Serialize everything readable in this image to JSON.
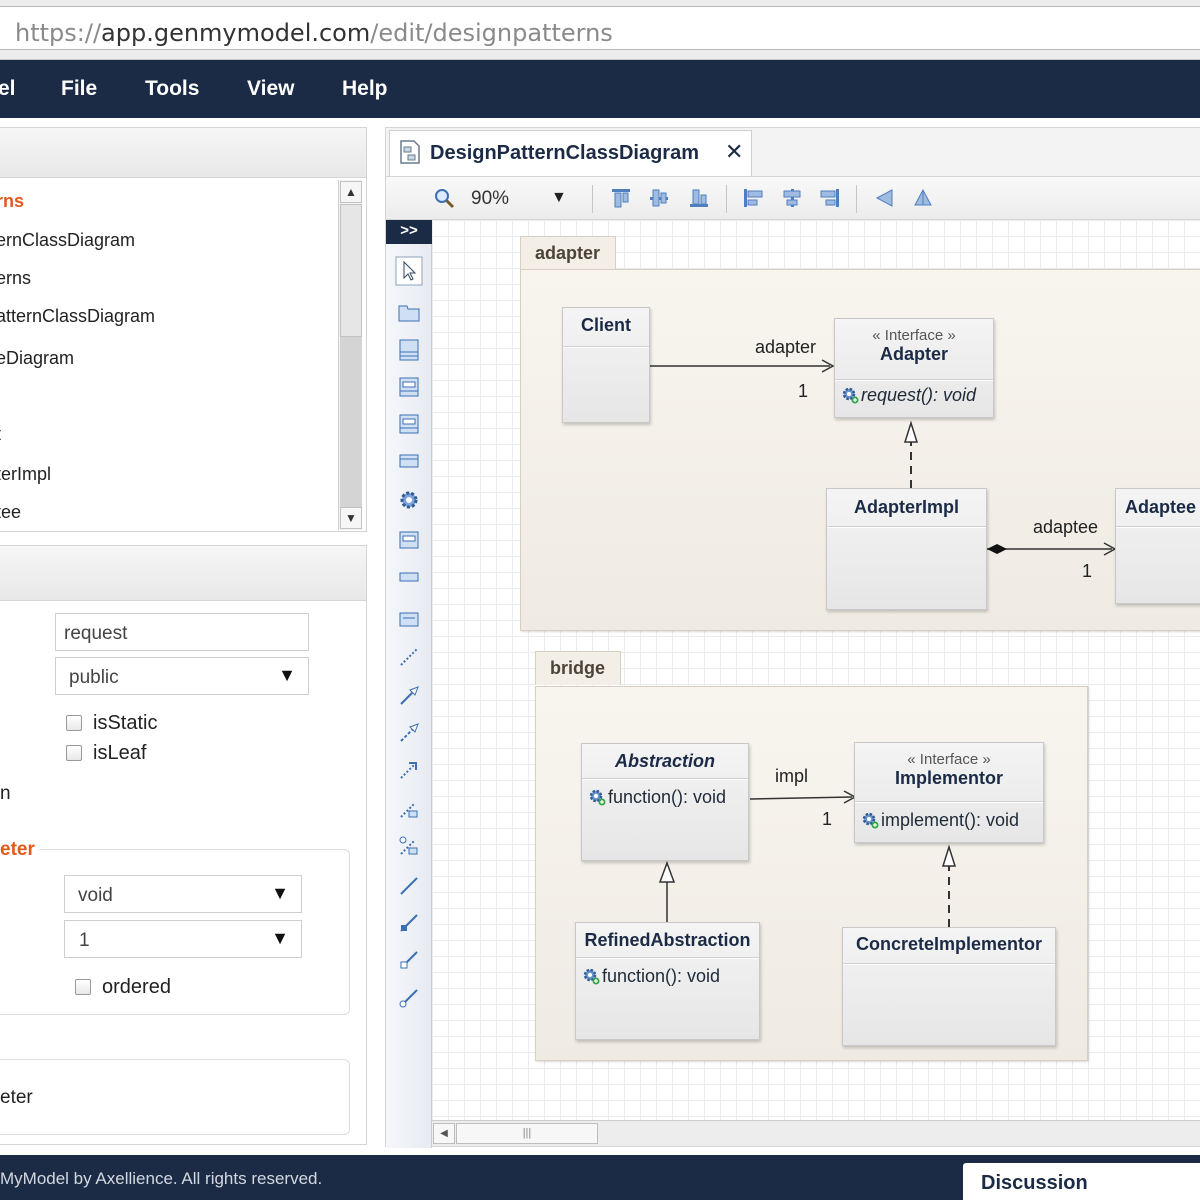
{
  "browser": {
    "url_scheme": "https://",
    "url_host": "app.genmymodel.com",
    "url_path": "/edit/designpatterns"
  },
  "menubar": {
    "items": [
      "el",
      "File",
      "Tools",
      "View",
      "Help"
    ]
  },
  "tree": {
    "items": [
      {
        "label": "rns",
        "selected": true
      },
      {
        "label": "ernClassDiagram"
      },
      {
        "label": "erns"
      },
      {
        "label": "atternClassDiagram"
      },
      {
        "label": "eDiagram"
      },
      {
        "label": "t"
      },
      {
        "label": "terImpl"
      },
      {
        "label": "tee"
      }
    ]
  },
  "properties": {
    "name_value": "request",
    "visibility_value": "public",
    "is_static_label": "isStatic",
    "is_leaf_label": "isLeaf",
    "truncated_label": "n",
    "return_section_title": "eter",
    "type_value": "void",
    "multiplicity_value": "1",
    "ordered_label": "ordered",
    "bottom_label": "eter"
  },
  "editor": {
    "tab_title": "DesignPatternClassDiagram",
    "tab_close": "✕",
    "zoom": "90%",
    "palette_toggle": ">>"
  },
  "diagram": {
    "packages": [
      {
        "name": "adapter"
      },
      {
        "name": "bridge"
      }
    ],
    "classes": {
      "client": {
        "name": "Client"
      },
      "adapter": {
        "stereotype": "« Interface »",
        "name": "Adapter",
        "operation": "request(): void"
      },
      "adapter_impl": {
        "name": "AdapterImpl"
      },
      "adaptee": {
        "name": "Adaptee"
      },
      "abstraction": {
        "name": "Abstraction",
        "operation": "function(): void"
      },
      "implementor": {
        "stereotype": "« Interface »",
        "name": "Implementor",
        "operation": "implement(): void"
      },
      "refined_abstraction": {
        "name": "RefinedAbstraction",
        "operation": "function(): void"
      },
      "concrete_implementor": {
        "name": "ConcreteImplementor"
      }
    },
    "edges": {
      "adapter_role": "adapter",
      "adapter_mult": "1",
      "adaptee_role": "adaptee",
      "adaptee_mult": "1",
      "impl_role": "impl",
      "impl_mult": "1"
    }
  },
  "footer": {
    "copyright": "MyModel by Axellience. All rights reserved.",
    "discussion": "Discussion"
  },
  "colors": {
    "navy": "#1b2b46",
    "accent_orange": "#e05a1a",
    "package_fill": "#f4efe6"
  }
}
